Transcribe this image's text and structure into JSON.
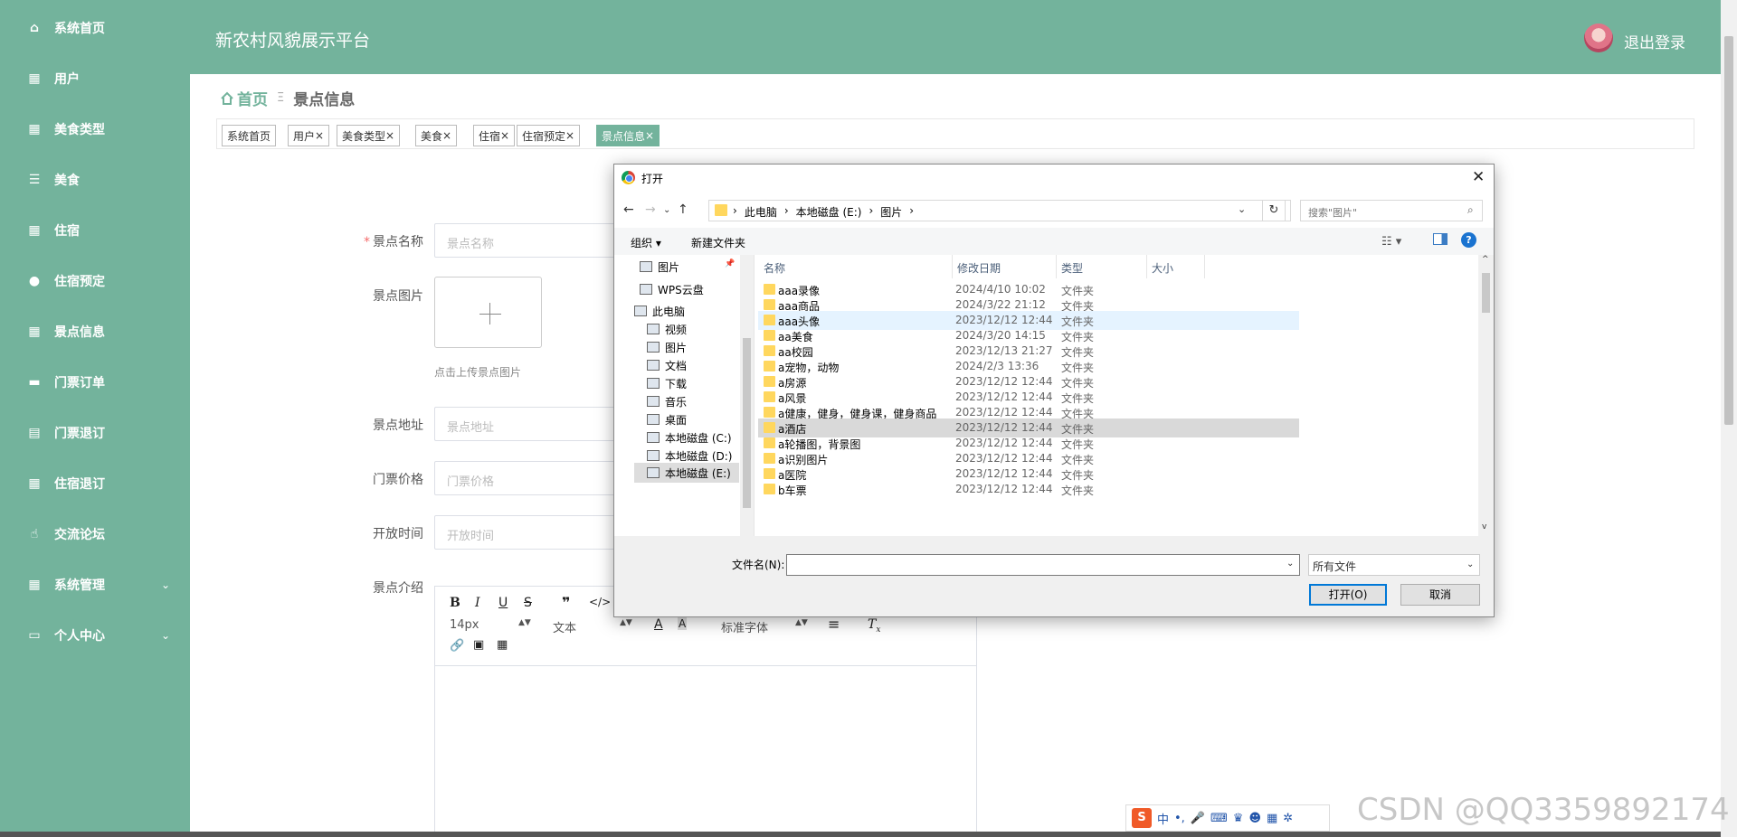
{
  "app": {
    "title": "新农村风貌展示平台",
    "logout": "退出登录"
  },
  "sidebar": {
    "items": [
      {
        "label": "系统首页",
        "icon": "home-icon"
      },
      {
        "label": "用户",
        "icon": "grid-icon"
      },
      {
        "label": "美食类型",
        "icon": "grid-icon"
      },
      {
        "label": "美食",
        "icon": "list-icon"
      },
      {
        "label": "住宿",
        "icon": "grid-icon"
      },
      {
        "label": "住宿预定",
        "icon": "bulb-icon"
      },
      {
        "label": "景点信息",
        "icon": "grid-icon"
      },
      {
        "label": "门票订单",
        "icon": "monitor-icon"
      },
      {
        "label": "门票退订",
        "icon": "clipboard-icon"
      },
      {
        "label": "住宿退订",
        "icon": "grid-icon"
      },
      {
        "label": "交流论坛",
        "icon": "thumb-icon"
      },
      {
        "label": "系统管理",
        "icon": "grid-icon",
        "caret": "⌄"
      },
      {
        "label": "个人中心",
        "icon": "card-icon",
        "caret": "⌄"
      }
    ]
  },
  "breadcrumb": {
    "home": "首页",
    "sep": "Ξ",
    "current": "景点信息"
  },
  "tags": [
    {
      "label": "系统首页"
    },
    {
      "label": "用户",
      "close": "×"
    },
    {
      "label": "美食类型",
      "close": "×"
    },
    {
      "label": "美食",
      "close": "×"
    },
    {
      "label": "住宿",
      "close": "×"
    },
    {
      "label": "住宿预定",
      "close": "×"
    },
    {
      "label": "景点信息",
      "close": "×",
      "active": true
    }
  ],
  "form": {
    "name_label": "景点名称",
    "name_placeholder": "景点名称",
    "image_label": "景点图片",
    "image_hint": "点击上传景点图片",
    "address_label": "景点地址",
    "address_placeholder": "景点地址",
    "price_label": "门票价格",
    "price_placeholder": "门票价格",
    "time_label": "开放时间",
    "time_placeholder": "开放时间",
    "intro_label": "景点介绍",
    "editor": {
      "font_size": "14px",
      "block_type": "文本",
      "font_family": "标准字体"
    }
  },
  "dialog": {
    "title": "打开",
    "path": [
      "此电脑",
      "本地磁盘 (E:)",
      "图片"
    ],
    "search_placeholder": "搜索\"图片\"",
    "organize": "组织 ▾",
    "new_folder": "新建文件夹",
    "nav_tree": [
      {
        "label": "图片"
      },
      {
        "label": "WPS云盘"
      },
      {
        "label": "此电脑"
      },
      {
        "label": "视频"
      },
      {
        "label": "图片"
      },
      {
        "label": "文档"
      },
      {
        "label": "下载"
      },
      {
        "label": "音乐"
      },
      {
        "label": "桌面"
      },
      {
        "label": "本地磁盘 (C:)"
      },
      {
        "label": "本地磁盘 (D:)"
      },
      {
        "label": "本地磁盘 (E:)",
        "selected": true
      }
    ],
    "columns": {
      "name": "名称",
      "date": "修改日期",
      "type": "类型",
      "size": "大小"
    },
    "files": [
      {
        "name": "aaa录像",
        "date": "2024/4/10 10:02",
        "type": "文件夹"
      },
      {
        "name": "aaa商品",
        "date": "2024/3/22 21:12",
        "type": "文件夹"
      },
      {
        "name": "aaa头像",
        "date": "2023/12/12 12:44",
        "type": "文件夹",
        "state": "hover"
      },
      {
        "name": "aa美食",
        "date": "2024/3/20 14:15",
        "type": "文件夹"
      },
      {
        "name": "aa校园",
        "date": "2023/12/13 21:27",
        "type": "文件夹"
      },
      {
        "name": "a宠物，动物",
        "date": "2024/2/3 13:36",
        "type": "文件夹"
      },
      {
        "name": "a房源",
        "date": "2023/12/12 12:44",
        "type": "文件夹"
      },
      {
        "name": "a风景",
        "date": "2023/12/12 12:44",
        "type": "文件夹"
      },
      {
        "name": "a健康，健身，健身课，健身商品",
        "date": "2023/12/12 12:44",
        "type": "文件夹"
      },
      {
        "name": "a酒店",
        "date": "2023/12/12 12:44",
        "type": "文件夹",
        "state": "selected"
      },
      {
        "name": "a轮播图，背景图",
        "date": "2023/12/12 12:44",
        "type": "文件夹"
      },
      {
        "name": "a识别图片",
        "date": "2023/12/12 12:44",
        "type": "文件夹"
      },
      {
        "name": "a医院",
        "date": "2023/12/12 12:44",
        "type": "文件夹"
      },
      {
        "name": "b车票",
        "date": "2023/12/12 12:44",
        "type": "文件夹"
      }
    ],
    "filename_label": "文件名(N):",
    "filename_value": "",
    "filetype": "所有文件",
    "open_button": "打开(O)",
    "cancel_button": "取消"
  },
  "ime": {
    "lang": "中"
  },
  "watermark": "CSDN @QQ3359892174",
  "colors": {
    "primary": "#73b39c",
    "dialog_accent": "#0078d7",
    "required": "#f56c6c"
  }
}
